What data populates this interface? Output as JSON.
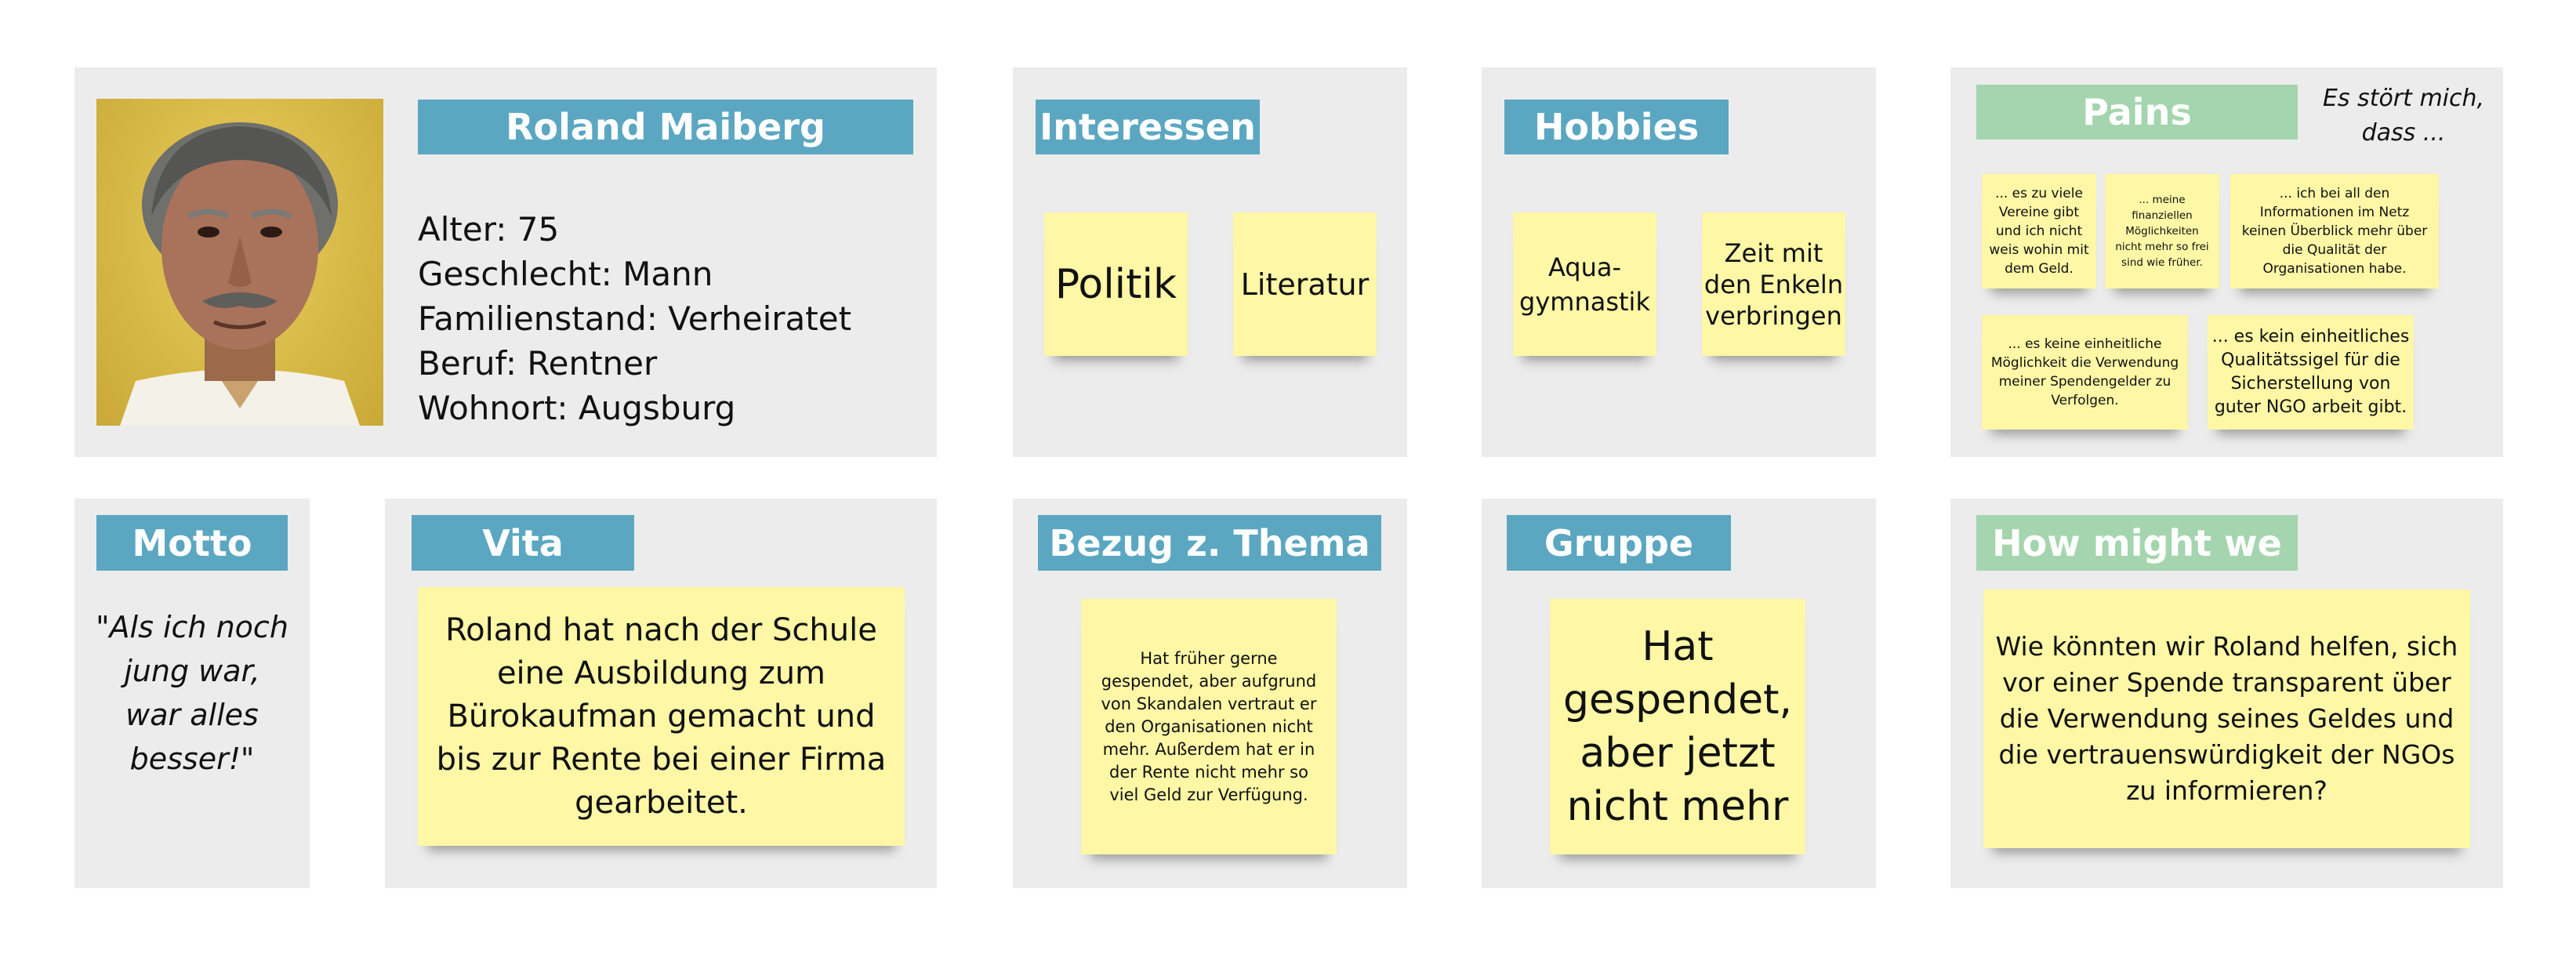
{
  "persona": {
    "name": "Roland Maiberg",
    "facts": [
      "Alter: 75",
      "Geschlecht: Mann",
      "Familienstand: Verheiratet",
      "Beruf: Rentner",
      "Wohnort: Augsburg"
    ]
  },
  "interessen": {
    "title": "Interessen",
    "notes": [
      "Politik",
      "Literatur"
    ]
  },
  "hobbies": {
    "title": "Hobbies",
    "notes": [
      "Aqua-\ngymnastik",
      "Zeit mit\nden Enkeln\nverbringen"
    ]
  },
  "pains": {
    "title": "Pains",
    "caption": "Es stört mich,\ndass ...",
    "notes": [
      "... es zu viele\nVereine gibt\nund ich nicht\nweis wohin mit\ndem Geld.",
      "... meine\nfinanziellen\nMöglichkeiten\nnicht mehr so frei\nsind wie früher.",
      "... ich bei all den\nInformationen im Netz\nkeinen Überblick mehr über\ndie Qualität der\nOrganisationen habe.",
      "... es keine einheitliche\nMöglichkeit die Verwendung\nmeiner Spendengelder zu\nVerfolgen.",
      "... es kein einheitliches\nQualitätssigel für die\nSicherstellung von\nguter NGO arbeit gibt."
    ]
  },
  "motto": {
    "title": "Motto",
    "quote": "\"Als ich noch\njung war,\nwar alles\nbesser!\""
  },
  "vita": {
    "title": "Vita",
    "text": "Roland hat nach der Schule\neine Ausbildung zum\nBürokaufman gemacht und\nbis zur Rente bei einer Firma\ngearbeitet."
  },
  "bezug": {
    "title": "Bezug z. Thema",
    "text": "Hat früher gerne\ngespendet, aber aufgrund\nvon Skandalen vertraut er\nden Organisationen nicht\nmehr. Außerdem hat er in\nder Rente nicht mehr so\nviel Geld zur Verfügung."
  },
  "gruppe": {
    "title": "Gruppe",
    "text": "Hat\ngespendet,\naber jetzt\nnicht mehr"
  },
  "hmw": {
    "title": "How might we",
    "text": "Wie könnten wir Roland helfen, sich\nvor einer Spende transparent über\ndie Verwendung seines Geldes und\ndie vertrauenswürdigkeit der NGOs\nzu informieren?"
  },
  "colors": {
    "tag_blue": "#5ba7c2",
    "tag_green": "#a5d5ae",
    "sticky": "#fdf7a6",
    "panel": "#ececec"
  }
}
